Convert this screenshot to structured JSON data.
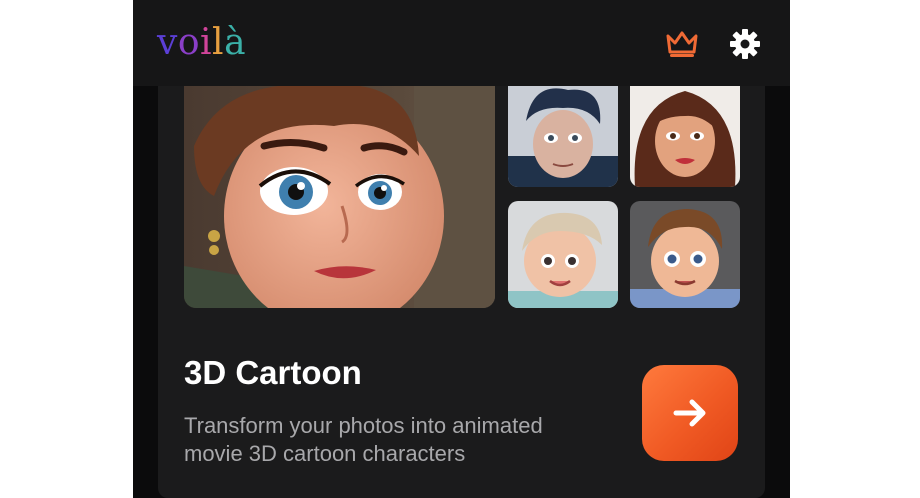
{
  "header": {
    "logo_letters": [
      "v",
      "o",
      "i",
      "l",
      "à"
    ],
    "logo_colors": [
      "#5b3fd6",
      "#8a3fc8",
      "#d0449a",
      "#e8a040",
      "#3bb0a8"
    ],
    "crown_icon": "crown-icon",
    "settings_icon": "gear-icon",
    "accent": "#f06a35"
  },
  "card": {
    "title": "3D Cartoon",
    "description": "Transform your photos into animated movie 3D cartoon characters",
    "go_icon": "arrow-right-icon",
    "button_color": "#f06028"
  }
}
